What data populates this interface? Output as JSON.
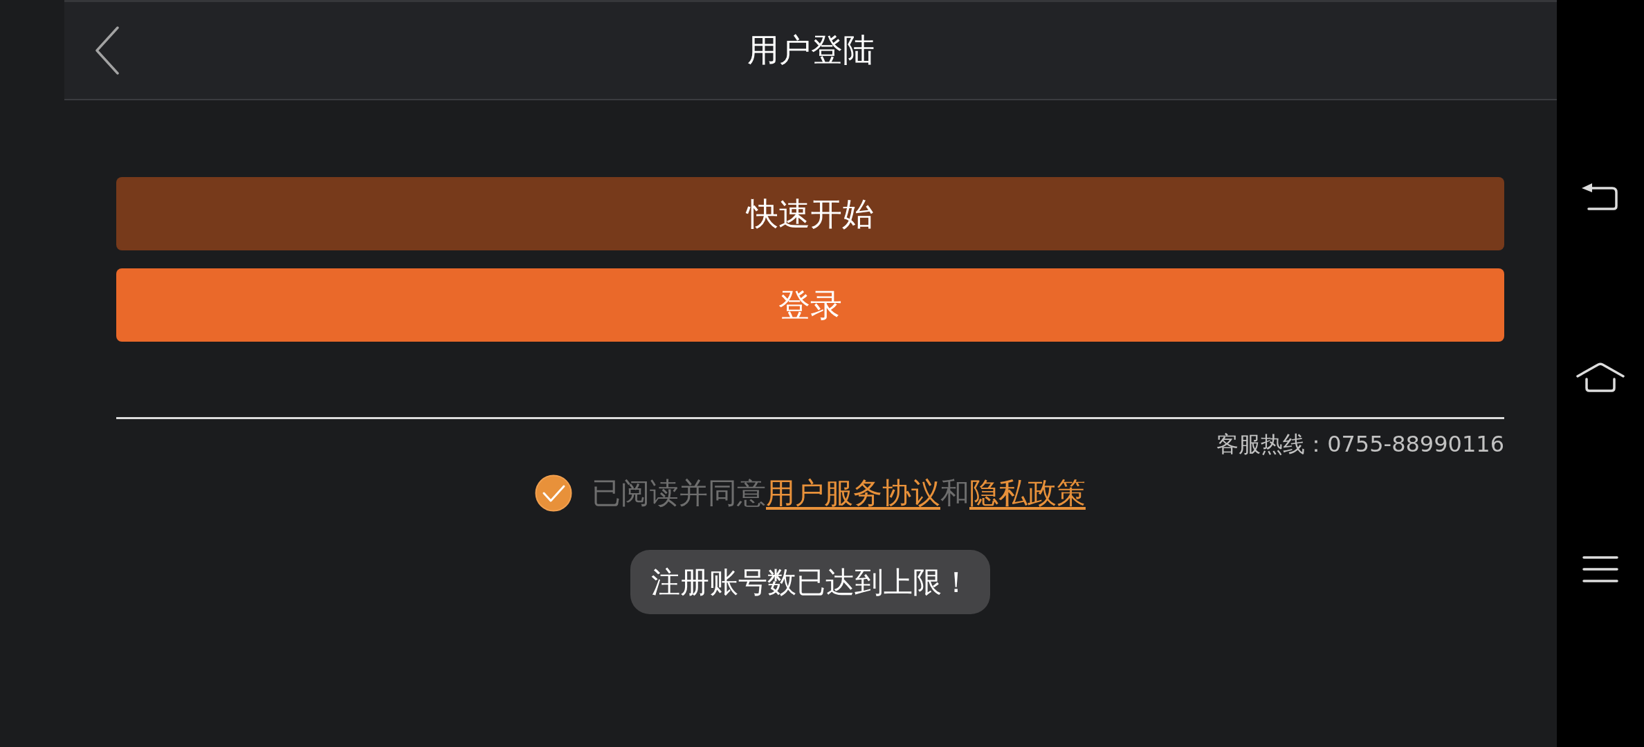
{
  "header": {
    "title": "用户登陆"
  },
  "buttons": [
    {
      "label": "快速开始",
      "kind": "secondary"
    },
    {
      "label": "登录",
      "kind": "primary"
    }
  ],
  "hotline": "客服热线：0755-88990116",
  "agreement": {
    "checked": true,
    "parts": [
      {
        "kind": "text",
        "text": "已阅读并同意"
      },
      {
        "kind": "link",
        "text": "用户服务协议"
      },
      {
        "kind": "text",
        "text": "和"
      },
      {
        "kind": "link",
        "text": "隐私政策"
      }
    ]
  },
  "toast": {
    "text": "注册账号数已达到上限！"
  }
}
